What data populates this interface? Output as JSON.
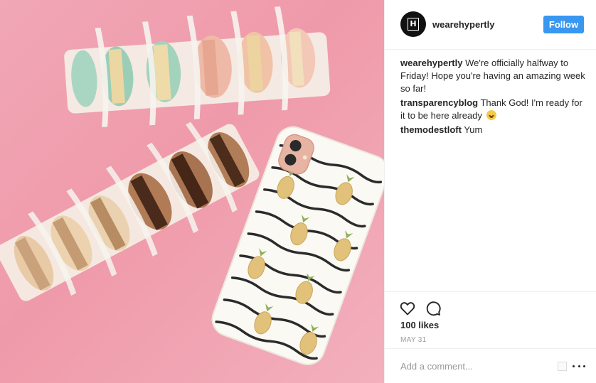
{
  "post": {
    "username": "wearehypertly",
    "avatar_letter": "H",
    "follow_label": "Follow",
    "comments": [
      {
        "user": "wearehypertly",
        "text": "We're officially halfway to Friday! Hope you're having an amazing week so far!"
      },
      {
        "user": "transparencyblog",
        "text": "Thank God! I'm ready for it to be here already",
        "emoji": "crying-laughing-emoji"
      },
      {
        "user": "themodestloft",
        "text": "Yum"
      }
    ],
    "likes": "100 likes",
    "date": "MAY 31",
    "add_comment_placeholder": "Add a comment...",
    "icons": {
      "like": "heart-icon",
      "comment": "comment-icon",
      "more": "more-options-icon"
    }
  },
  "colors": {
    "accent": "#3897f0",
    "background_photo": "#ef9aaa",
    "text": "#262626",
    "muted": "#999999",
    "border": "#efefef"
  }
}
